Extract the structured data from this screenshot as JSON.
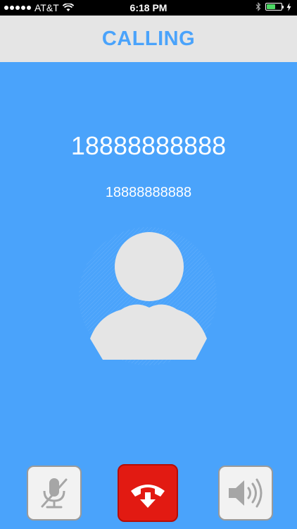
{
  "status_bar": {
    "carrier": "AT&T",
    "time": "6:18 PM"
  },
  "header": {
    "title": "CALLING"
  },
  "call": {
    "number_primary": "18888888888",
    "number_secondary": "18888888888"
  },
  "colors": {
    "background": "#4aa3fb",
    "header_bg": "#e5e5e5",
    "accent": "#4aa3fb",
    "end_call": "#e21a12"
  },
  "icons": {
    "avatar": "person-silhouette-icon",
    "mute": "microphone-muted-icon",
    "end_call": "end-call-icon",
    "speaker": "speaker-icon"
  }
}
